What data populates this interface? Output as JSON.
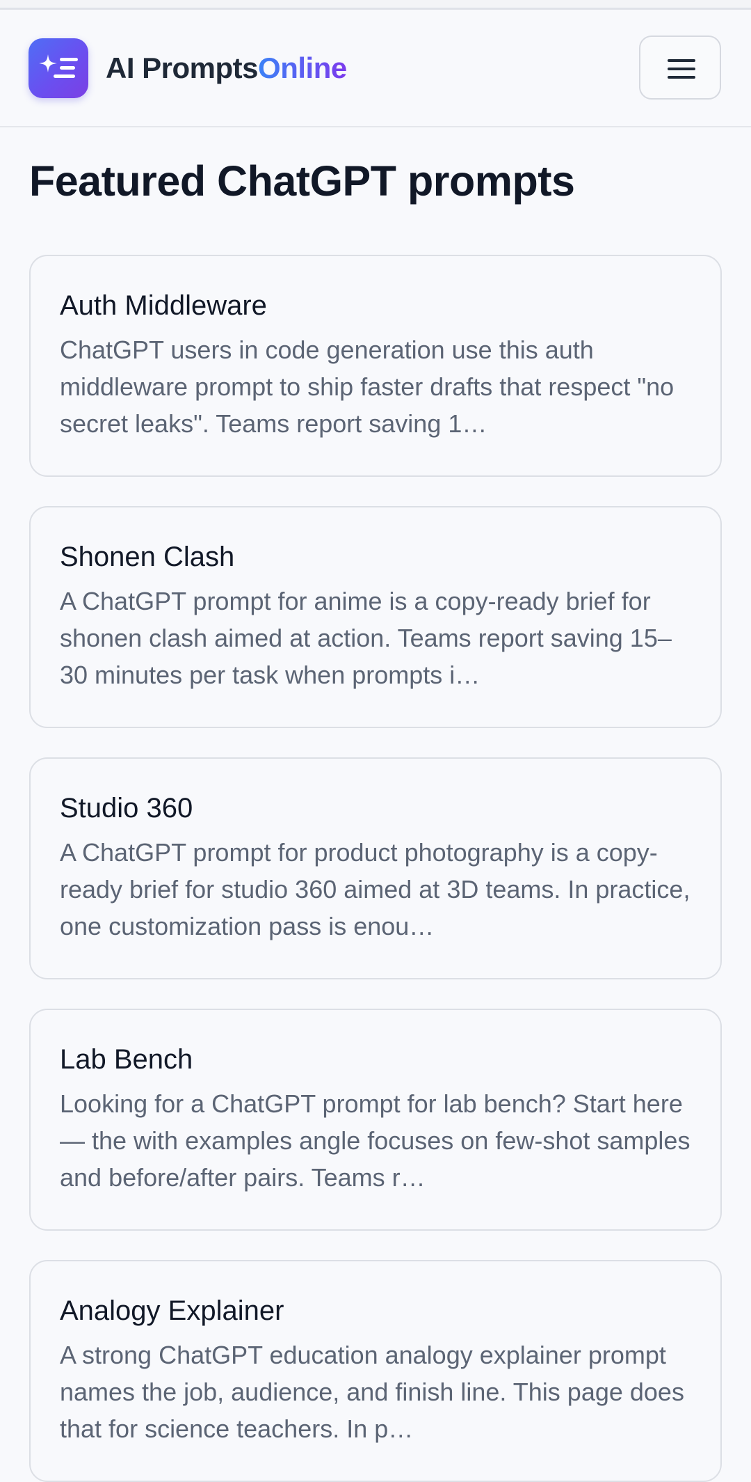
{
  "header": {
    "brand_main": "AI Prompts",
    "brand_accent": "Online",
    "logo_icon": "sparkle-list-icon",
    "menu_icon": "hamburger-menu-icon",
    "accent_colors": [
      "#4f6ef5",
      "#7c3aed"
    ]
  },
  "main": {
    "title": "Featured ChatGPT prompts",
    "cards": [
      {
        "title": "Auth Middleware",
        "description": "ChatGPT users in code generation use this auth middleware prompt to ship faster drafts that respect \"no secret leaks\". Teams report saving 1…"
      },
      {
        "title": "Shonen Clash",
        "description": "A ChatGPT prompt for anime is a copy-ready brief for shonen clash aimed at action. Teams report saving 15–30 minutes per task when prompts i…"
      },
      {
        "title": "Studio 360",
        "description": "A ChatGPT prompt for product photography is a copy-ready brief for studio 360 aimed at 3D teams. In practice, one customization pass is enou…"
      },
      {
        "title": "Lab Bench",
        "description": "Looking for a ChatGPT prompt for lab bench? Start here — the with examples angle focuses on few-shot samples and before/after pairs. Teams r…"
      },
      {
        "title": "Analogy Explainer",
        "description": "A strong ChatGPT education analogy explainer prompt names the job, audience, and finish line. This page does that for science teachers. In p…"
      }
    ]
  }
}
